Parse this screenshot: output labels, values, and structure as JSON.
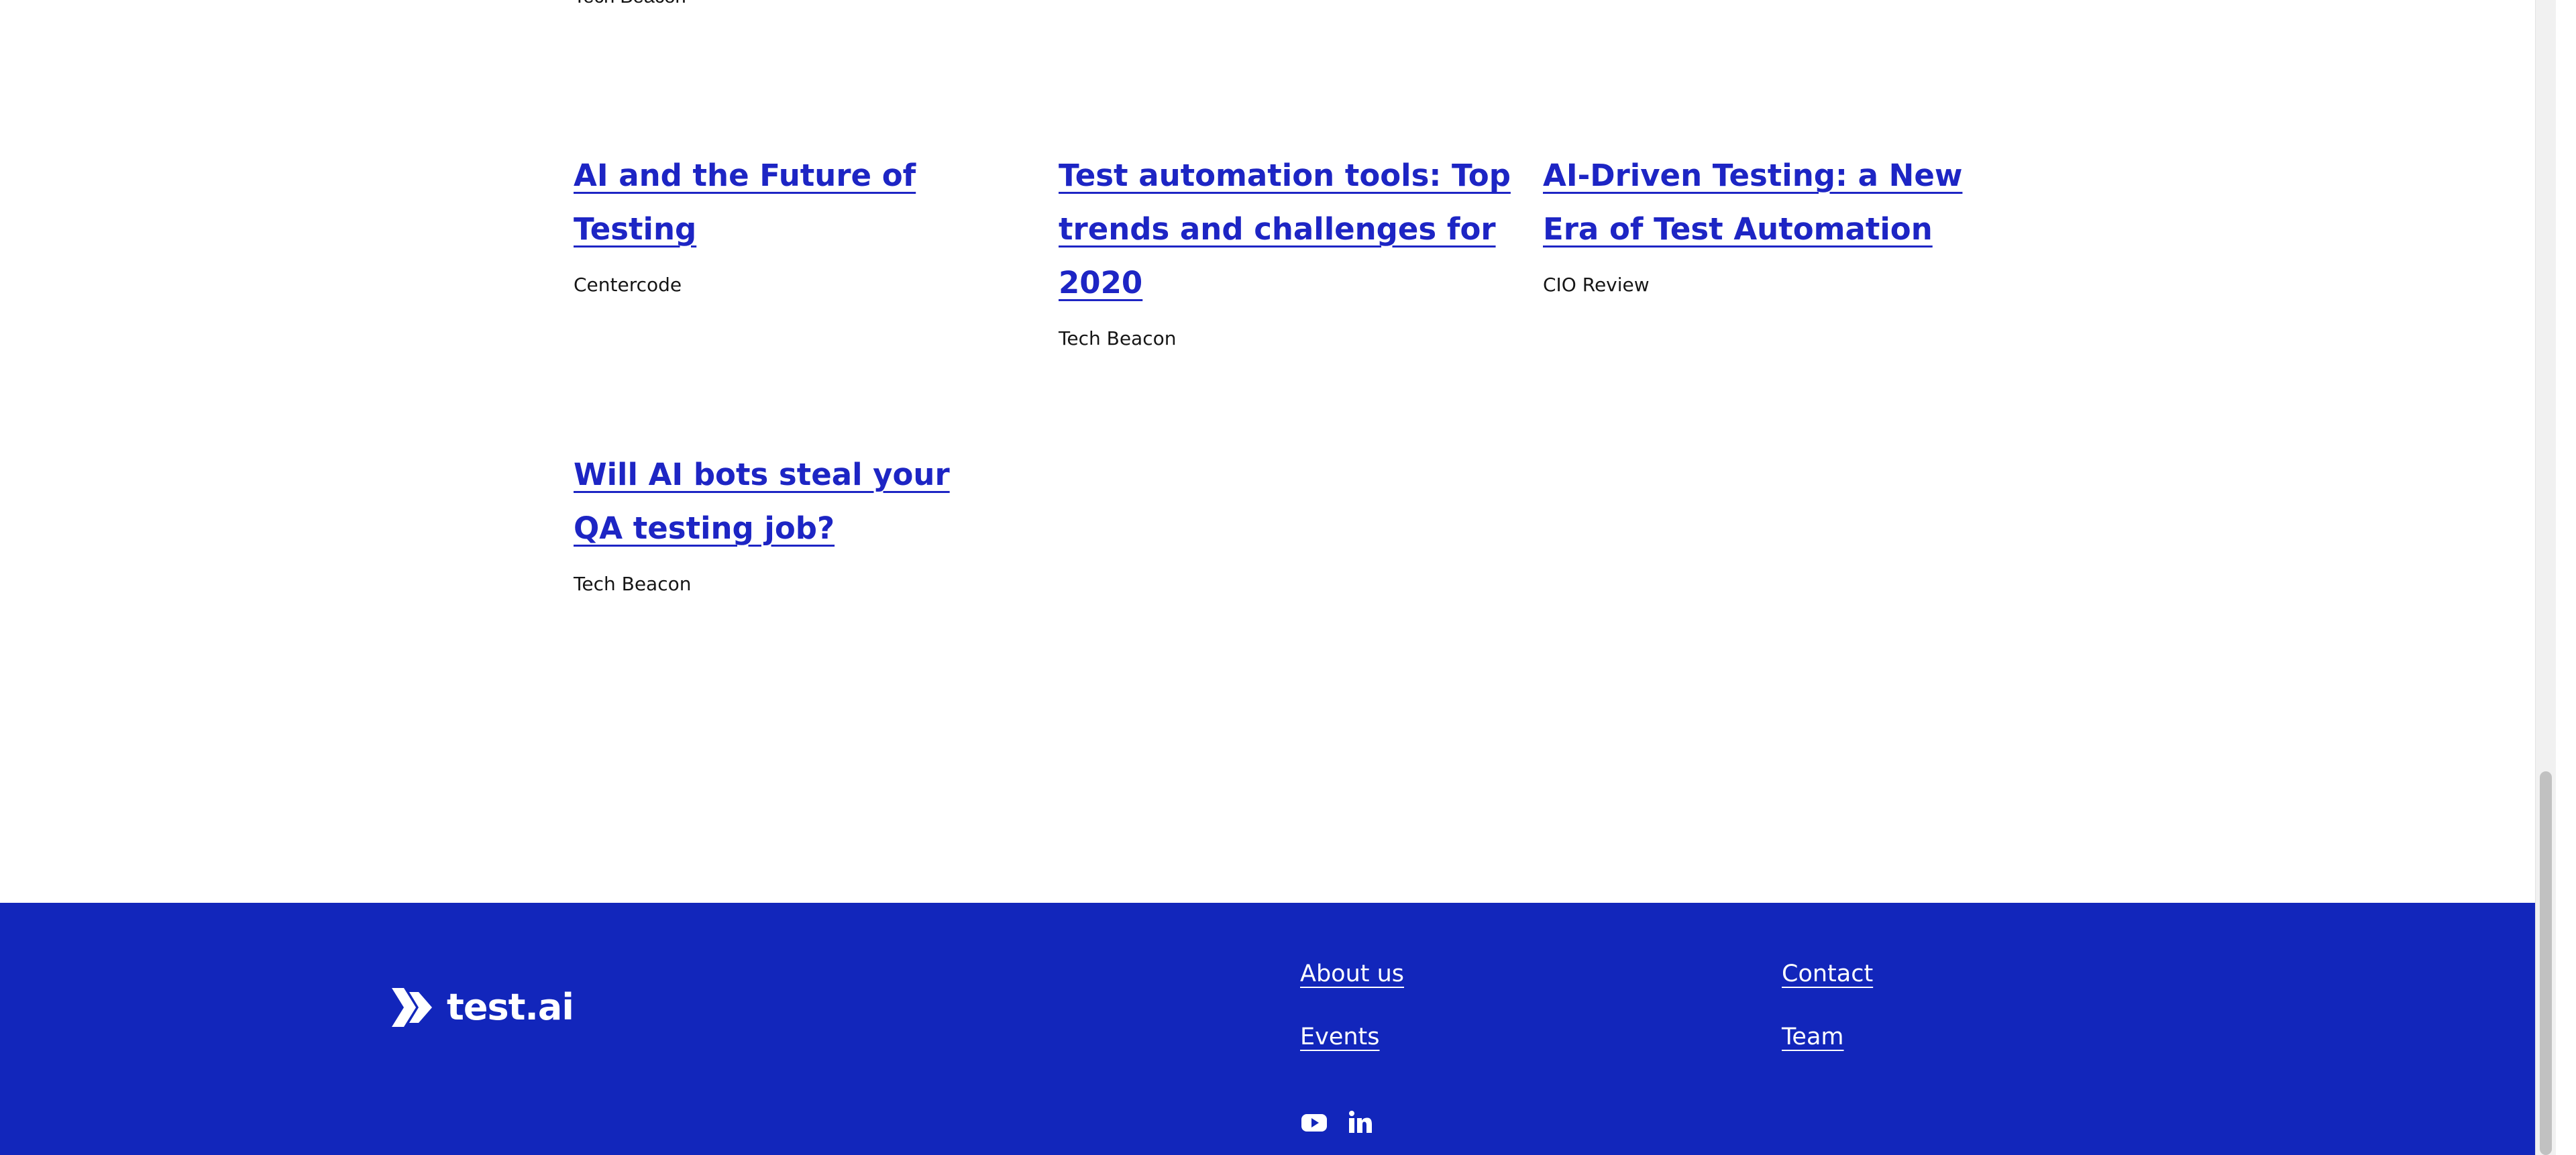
{
  "above_fold": {
    "cutoff_source": "Tech Beacon"
  },
  "articles": [
    {
      "title": "AI and the Future of Testing",
      "source": "Centercode"
    },
    {
      "title": "Test automation tools: Top trends and challenges for 2020",
      "source": "Tech Beacon"
    },
    {
      "title": "AI-Driven Testing: a New Era of Test Automation",
      "source": "CIO Review"
    },
    {
      "title": "Will AI bots steal your QA testing job?",
      "source": "Tech Beacon"
    }
  ],
  "footer": {
    "logo_text": "test.ai",
    "links": {
      "about": "About us",
      "events": "Events",
      "contact": "Contact",
      "team": "Team"
    },
    "social": [
      "youtube-icon",
      "linkedin-icon"
    ]
  },
  "colors": {
    "link": "#1d25c4",
    "footer_bg": "#1226bb",
    "text": "#161616",
    "white": "#ffffff"
  }
}
